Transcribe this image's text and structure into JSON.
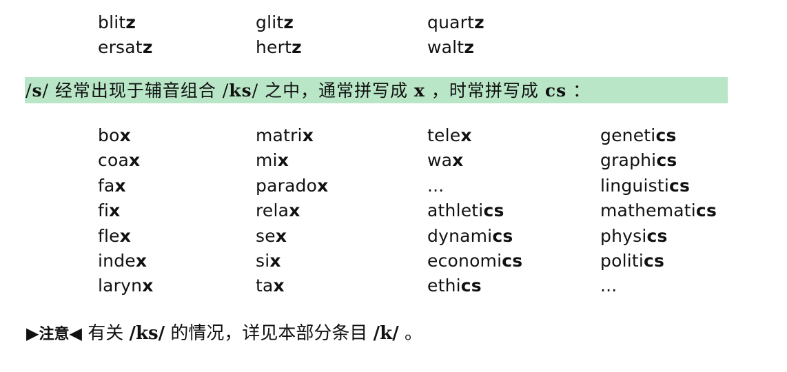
{
  "top_words": [
    [
      {
        "stem": "blit",
        "ending": "z"
      },
      {
        "stem": "glit",
        "ending": "z"
      },
      {
        "stem": "quart",
        "ending": "z"
      }
    ],
    [
      {
        "stem": "ersat",
        "ending": "z"
      },
      {
        "stem": "hert",
        "ending": "z"
      },
      {
        "stem": "walt",
        "ending": "z"
      }
    ]
  ],
  "rule": {
    "ph_open": "/",
    "phoneme": "s",
    "ph_close": "/",
    "text1": " 经常出现于辅音组合 ",
    "combo_open": "/",
    "combo": "ks",
    "combo_close": "/",
    "text2": " 之中，通常拼写成 ",
    "spelling1": "x",
    "text3": " ，时常拼写成 ",
    "spelling2": "cs",
    "text4": " ："
  },
  "main_words": [
    [
      {
        "stem": "bo",
        "ending": "x"
      },
      {
        "stem": "matri",
        "ending": "x"
      },
      {
        "stem": "tele",
        "ending": "x"
      },
      {
        "stem": "geneti",
        "ending": "cs"
      }
    ],
    [
      {
        "stem": "coa",
        "ending": "x"
      },
      {
        "stem": "mi",
        "ending": "x"
      },
      {
        "stem": "wa",
        "ending": "x"
      },
      {
        "stem": "graphi",
        "ending": "cs"
      }
    ],
    [
      {
        "stem": "fa",
        "ending": "x"
      },
      {
        "stem": "parado",
        "ending": "x"
      },
      {
        "stem": "...",
        "ending": ""
      },
      {
        "stem": "linguisti",
        "ending": "cs"
      }
    ],
    [
      {
        "stem": "fi",
        "ending": "x"
      },
      {
        "stem": "rela",
        "ending": "x"
      },
      {
        "stem": "athleti",
        "ending": "cs"
      },
      {
        "stem": "mathemati",
        "ending": "cs"
      }
    ],
    [
      {
        "stem": "fle",
        "ending": "x"
      },
      {
        "stem": "se",
        "ending": "x"
      },
      {
        "stem": "dynami",
        "ending": "cs"
      },
      {
        "stem": "physi",
        "ending": "cs"
      }
    ],
    [
      {
        "stem": "inde",
        "ending": "x"
      },
      {
        "stem": "si",
        "ending": "x"
      },
      {
        "stem": "economi",
        "ending": "cs"
      },
      {
        "stem": "politi",
        "ending": "cs"
      }
    ],
    [
      {
        "stem": "laryn",
        "ending": "x"
      },
      {
        "stem": "ta",
        "ending": "x"
      },
      {
        "stem": "ethi",
        "ending": "cs"
      },
      {
        "stem": "...",
        "ending": ""
      }
    ]
  ],
  "note": {
    "marker_left": "▶",
    "label": "注意",
    "marker_right": "◀",
    "text1": " 有关 ",
    "ph1_open": "/",
    "ph1": "ks",
    "ph1_close": "/",
    "text2": " 的情况，详见本部分条目 ",
    "ph2_open": "/",
    "ph2": "k",
    "ph2_close": "/",
    "text3": " 。"
  }
}
